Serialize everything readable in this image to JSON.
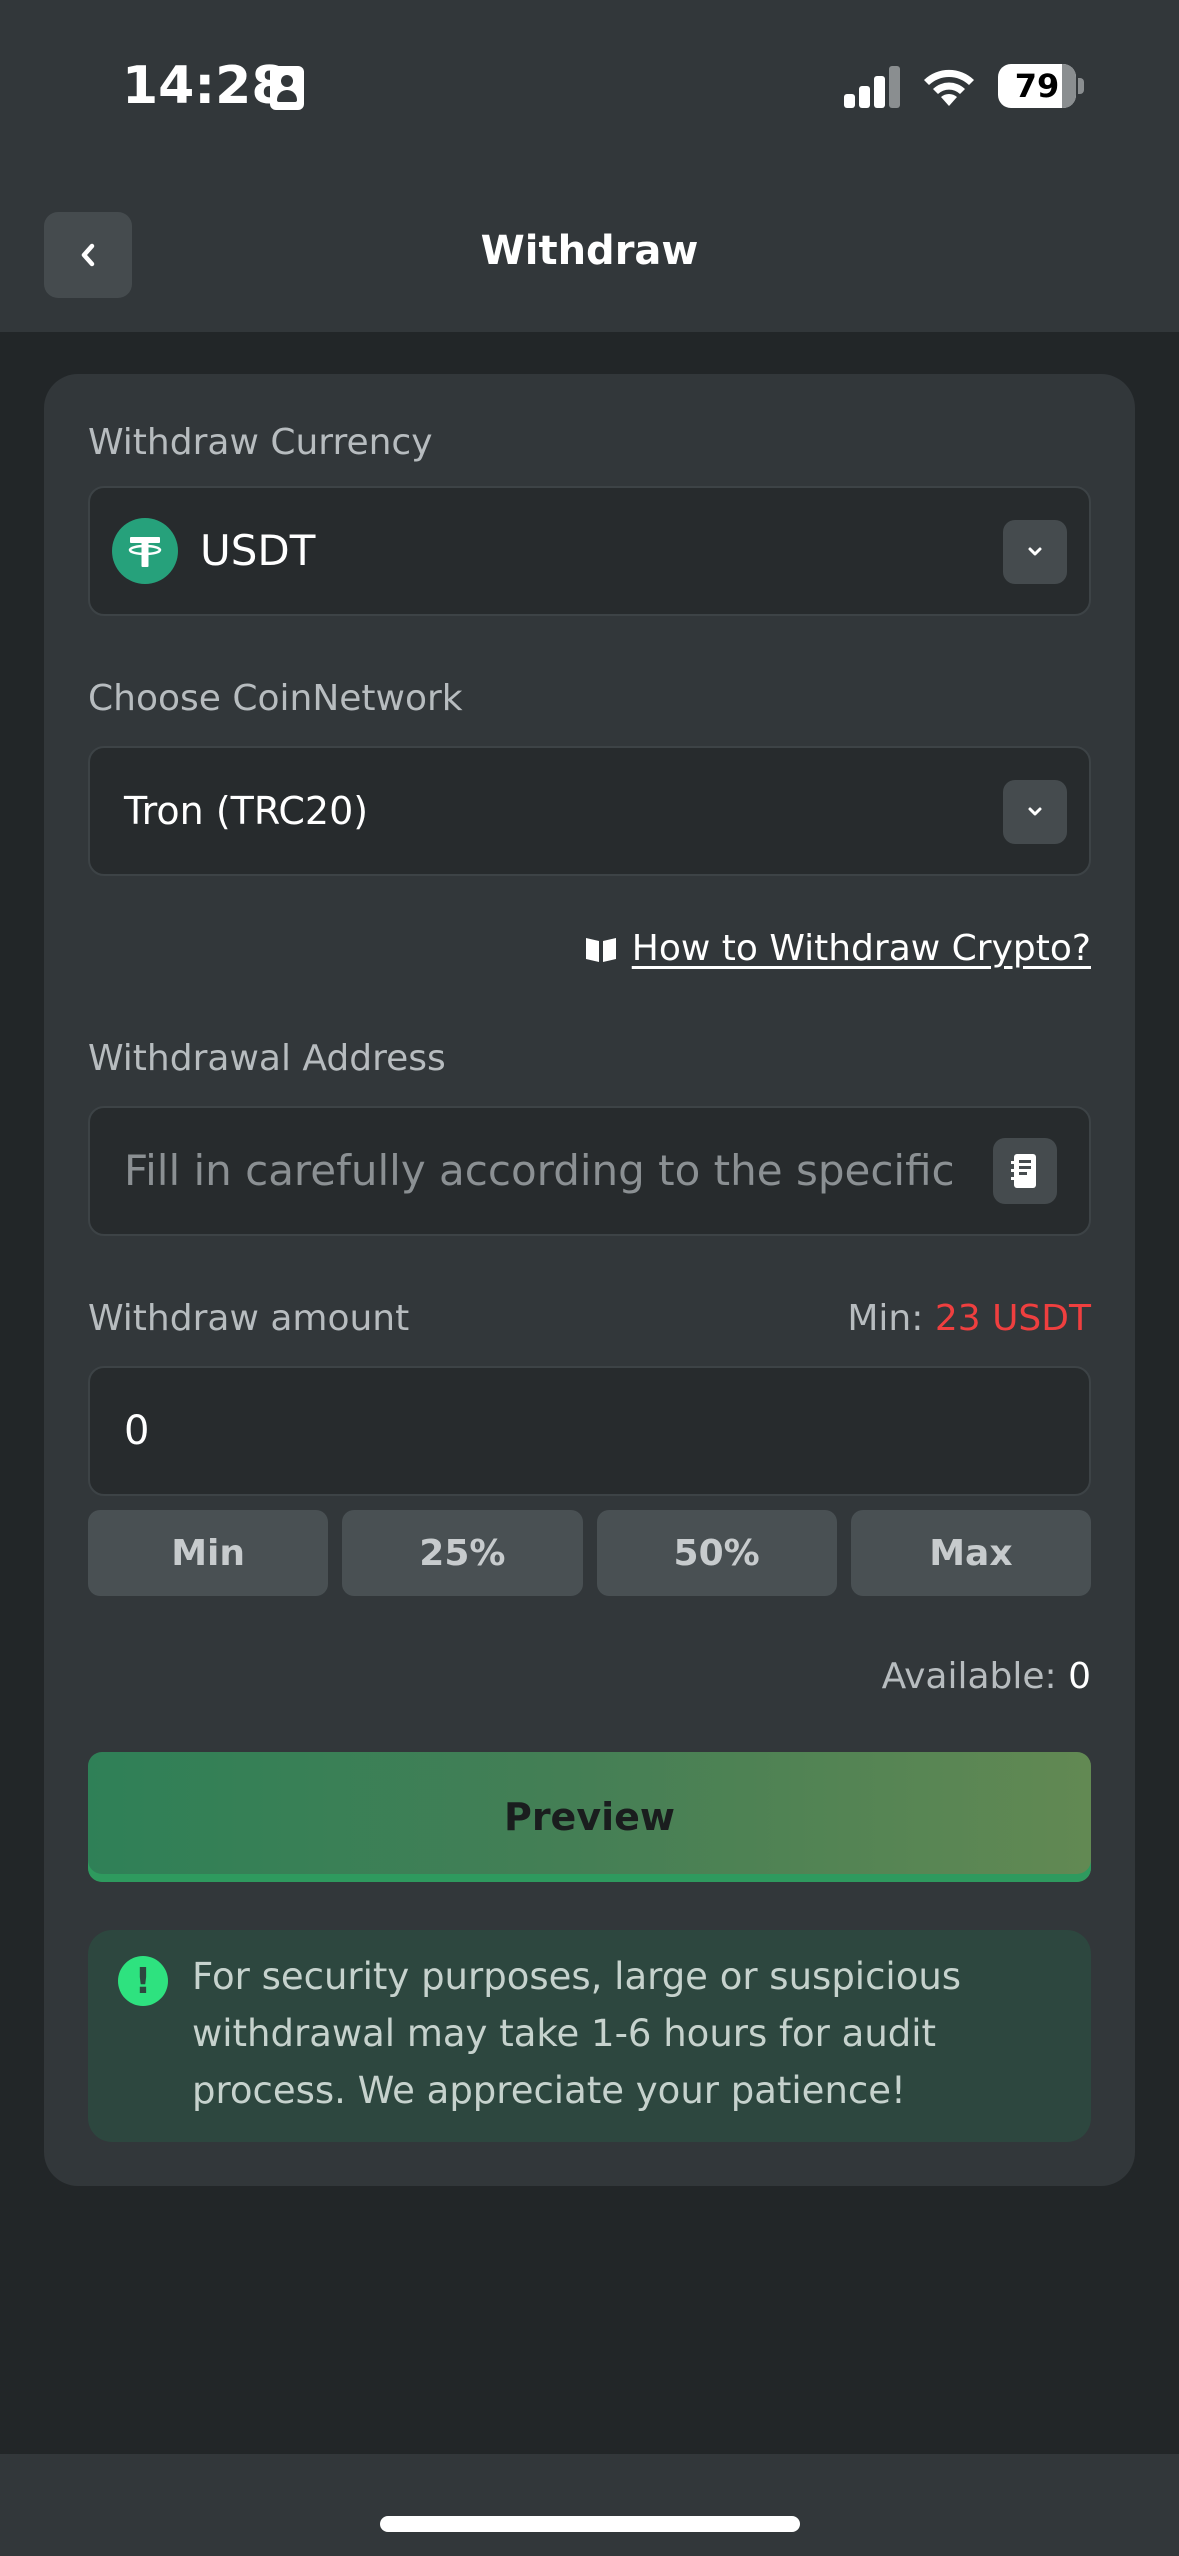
{
  "status_bar": {
    "time": "14:28",
    "battery": "79"
  },
  "nav": {
    "title": "Withdraw"
  },
  "form": {
    "currency_label": "Withdraw Currency",
    "currency_value": "USDT",
    "network_label": "Choose CoinNetwork",
    "network_value": "Tron (TRC20)",
    "howto_link": "How to Withdraw Crypto?",
    "address_label": "Withdrawal Address",
    "address_placeholder": "Fill in carefully according to the specific c",
    "amount_label": "Withdraw amount",
    "min_prefix": "Min:",
    "min_value": "23 USDT",
    "amount_value": "0",
    "quick_buttons": [
      "Min",
      "25%",
      "50%",
      "Max"
    ],
    "available_label": "Available:",
    "available_value": "0",
    "preview_button": "Preview"
  },
  "notice": {
    "icon": "!",
    "text": "For security purposes, large or suspicious withdrawal may take 1-6 hours for audit process. We appreciate your patience!"
  },
  "colors": {
    "accent_green": "#2ee27f",
    "min_red": "#ef3f3f",
    "tether_green": "#26a17b"
  }
}
